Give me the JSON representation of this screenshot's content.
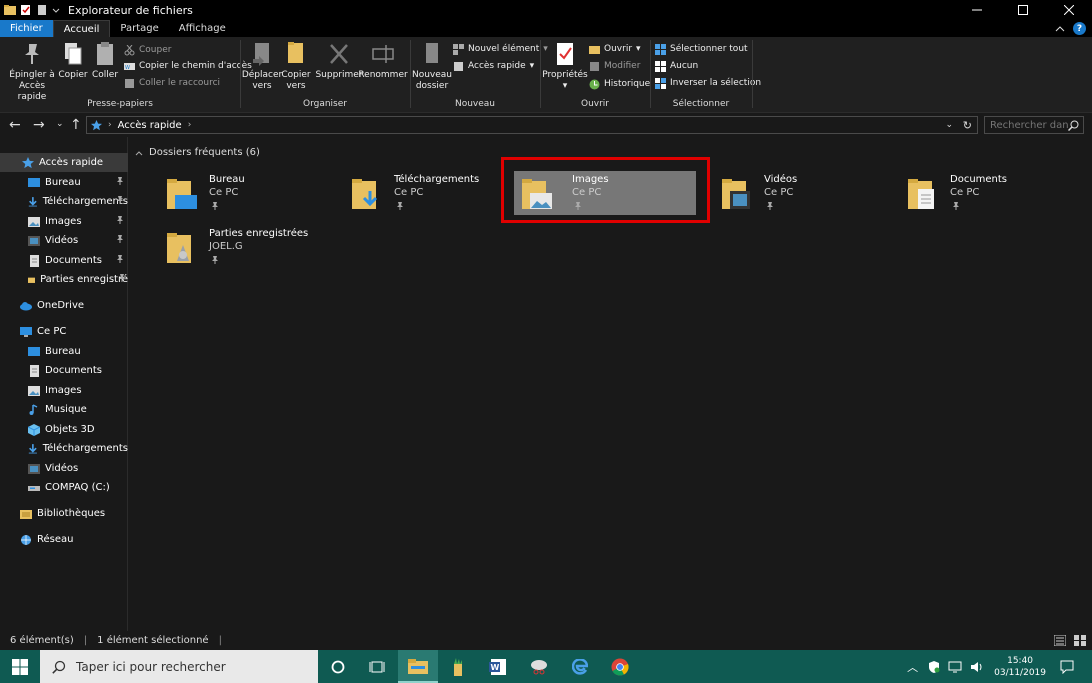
{
  "window": {
    "title": "Explorateur de fichiers"
  },
  "tabs": {
    "file": "Fichier",
    "home": "Accueil",
    "share": "Partage",
    "view": "Affichage"
  },
  "ribbon": {
    "clipboard": {
      "label": "Presse-papiers",
      "pin": "Épingler à\nAccès rapide",
      "pin_l1": "Épingler à",
      "pin_l2": "Accès rapide",
      "copy": "Copier",
      "paste": "Coller",
      "cut": "Couper",
      "copy_path": "Copier le chemin d'accès",
      "paste_shortcut": "Coller le raccourci"
    },
    "organize": {
      "label": "Organiser",
      "move_l1": "Déplacer",
      "move_l2": "vers",
      "copy_l1": "Copier",
      "copy_l2": "vers",
      "delete": "Supprimer",
      "rename": "Renommer"
    },
    "new": {
      "label": "Nouveau",
      "folder_l1": "Nouveau",
      "folder_l2": "dossier",
      "new_item": "Nouvel élément",
      "easy_access": "Accès rapide"
    },
    "open": {
      "label": "Ouvrir",
      "properties": "Propriétés",
      "open": "Ouvrir",
      "edit": "Modifier",
      "history": "Historique"
    },
    "select": {
      "label": "Sélectionner",
      "all": "Sélectionner tout",
      "none": "Aucun",
      "invert": "Inverser la sélection"
    }
  },
  "address": {
    "path": "Accès rapide",
    "search_placeholder": "Rechercher dan..."
  },
  "nav": {
    "quick_access": "Accès rapide",
    "quick_items": [
      "Bureau",
      "Téléchargements",
      "Images",
      "Vidéos",
      "Documents",
      "Parties enregistré"
    ],
    "onedrive": "OneDrive",
    "thispc": "Ce PC",
    "pc_items": [
      "Bureau",
      "Documents",
      "Images",
      "Musique",
      "Objets 3D",
      "Téléchargements",
      "Vidéos",
      "COMPAQ (C:)"
    ],
    "libraries": "Bibliothèques",
    "network": "Réseau"
  },
  "content": {
    "section": "Dossiers fréquents (6)",
    "tiles": [
      {
        "name": "Bureau",
        "sub": "Ce PC"
      },
      {
        "name": "Téléchargements",
        "sub": "Ce PC"
      },
      {
        "name": "Images",
        "sub": "Ce PC"
      },
      {
        "name": "Vidéos",
        "sub": "Ce PC"
      },
      {
        "name": "Documents",
        "sub": "Ce PC"
      },
      {
        "name": "Parties enregistrées",
        "sub": "JOEL.G"
      }
    ]
  },
  "status": {
    "count": "6 élément(s)",
    "selected": "1 élément sélectionné"
  },
  "taskbar": {
    "search_placeholder": "Taper ici pour rechercher",
    "time": "15:40",
    "date": "03/11/2019"
  },
  "colors": {
    "accent": "#1979ca",
    "highlight_box": "#e00000",
    "taskbar": "#0f5a52",
    "folder": "#e8c060"
  }
}
